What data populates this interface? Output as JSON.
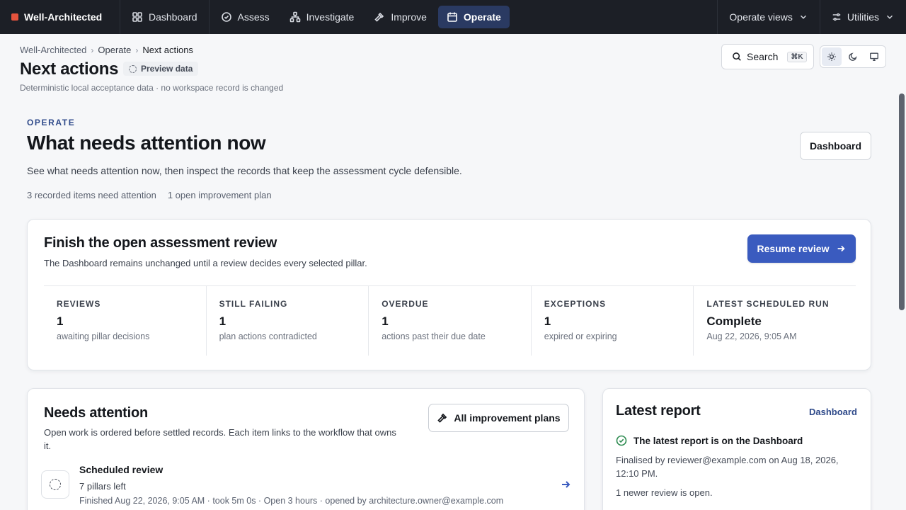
{
  "nav": {
    "brand": "Well-Architected",
    "items": [
      {
        "label": "Dashboard",
        "icon": "grid-icon"
      },
      {
        "label": "Assess",
        "icon": "check-circle-icon"
      },
      {
        "label": "Investigate",
        "icon": "network-icon"
      },
      {
        "label": "Improve",
        "icon": "hammer-icon"
      },
      {
        "label": "Operate",
        "icon": "calendar-icon",
        "active": true
      }
    ],
    "operate_views": "Operate views",
    "utilities": "Utilities"
  },
  "header": {
    "breadcrumb": [
      "Well-Architected",
      "Operate",
      "Next actions"
    ],
    "title": "Next actions",
    "badge": "Preview data",
    "subtitle": "Deterministic local acceptance data · no workspace record is changed",
    "search_label": "Search",
    "search_shortcut": "⌘K"
  },
  "operate": {
    "eyebrow": "OPERATE",
    "heading": "What needs attention now",
    "description": "See what needs attention now, then inspect the records that keep the assessment cycle defensible.",
    "meta": [
      "3 recorded items need attention",
      "1 open improvement plan"
    ],
    "dashboard_button": "Dashboard"
  },
  "review": {
    "title": "Finish the open assessment review",
    "subtitle": "The Dashboard remains unchanged until a review decides every selected pillar.",
    "button": "Resume review",
    "stats": [
      {
        "label": "REVIEWS",
        "value": "1",
        "desc": "awaiting pillar decisions"
      },
      {
        "label": "STILL FAILING",
        "value": "1",
        "desc": "plan actions contradicted"
      },
      {
        "label": "OVERDUE",
        "value": "1",
        "desc": "actions past their due date"
      },
      {
        "label": "EXCEPTIONS",
        "value": "1",
        "desc": "expired or expiring"
      },
      {
        "label": "LATEST SCHEDULED RUN",
        "value": "Complete",
        "desc": "Aug 22, 2026, 9:05 AM"
      }
    ]
  },
  "needs": {
    "title": "Needs attention",
    "subtitle": "Open work is ordered before settled records. Each item links to the workflow that owns it.",
    "button": "All improvement plans",
    "item": {
      "title": "Scheduled review",
      "line1": "7 pillars left",
      "line2": "Finished Aug 22, 2026, 9:05 AM · took 5m 0s · Open 3 hours · opened by architecture.owner@example.com"
    }
  },
  "report": {
    "title": "Latest report",
    "link": "Dashboard",
    "status": "The latest report is on the Dashboard",
    "detail": "Finalised by reviewer@example.com on Aug 18, 2026, 12:10 PM.",
    "newer": "1 newer review is open."
  }
}
